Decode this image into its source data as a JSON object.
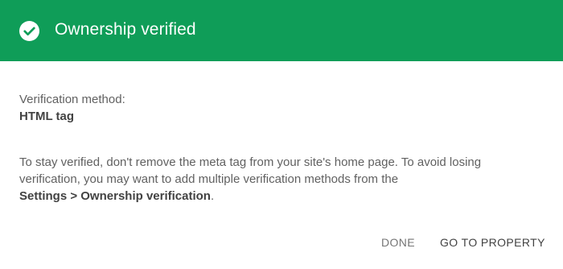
{
  "header": {
    "title": "Ownership verified",
    "icon": "check-circle-icon",
    "background_color": "#0f9d58"
  },
  "verification": {
    "method_label": "Verification method:",
    "method_value": "HTML tag"
  },
  "info": {
    "text_line1": "To stay verified, don't remove the meta tag from your site's home page. To avoid losing",
    "text_line2": "verification, you may want to add multiple verification methods from the",
    "settings_path": "Settings > Ownership verification",
    "trailing_period": "."
  },
  "actions": {
    "done_label": "DONE",
    "go_to_property_label": "GO TO PROPERTY"
  }
}
